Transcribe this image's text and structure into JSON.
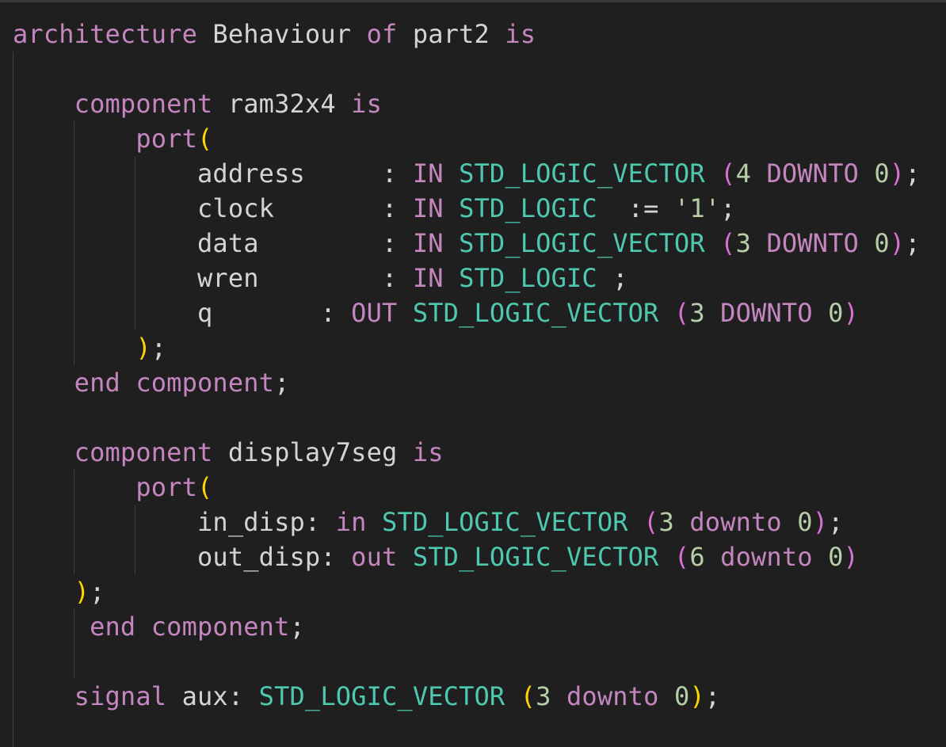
{
  "theme": {
    "background": "#1f1f1f",
    "keyword": "#c586c0",
    "identifier": "#d4d4d4",
    "type": "#4ec9b0",
    "number": "#b5cea8",
    "bracket_level1": "#ffd700",
    "bracket_level2": "#da70d6",
    "string": "#ce9178"
  },
  "lines": [
    {
      "tokens": [
        {
          "text": "architecture",
          "kind": "kw"
        },
        {
          "text": " Behaviour ",
          "kind": "id"
        },
        {
          "text": "of",
          "kind": "kw"
        },
        {
          "text": " part2 ",
          "kind": "id"
        },
        {
          "text": "is",
          "kind": "kw"
        }
      ]
    },
    {
      "tokens": []
    },
    {
      "tokens": [
        {
          "text": "    "
        },
        {
          "text": "component",
          "kind": "kw"
        },
        {
          "text": " ram32x4 ",
          "kind": "id"
        },
        {
          "text": "is",
          "kind": "kw"
        }
      ]
    },
    {
      "tokens": [
        {
          "text": "        "
        },
        {
          "text": "port",
          "kind": "kw"
        },
        {
          "text": "(",
          "kind": "paren1"
        }
      ]
    },
    {
      "tokens": [
        {
          "text": "            "
        },
        {
          "text": "address     : ",
          "kind": "id"
        },
        {
          "text": "IN",
          "kind": "kw"
        },
        {
          "text": " "
        },
        {
          "text": "STD_LOGIC_VECTOR",
          "kind": "type"
        },
        {
          "text": " "
        },
        {
          "text": "(",
          "kind": "paren2"
        },
        {
          "text": "4",
          "kind": "num"
        },
        {
          "text": " "
        },
        {
          "text": "DOWNTO",
          "kind": "kw"
        },
        {
          "text": " "
        },
        {
          "text": "0",
          "kind": "num"
        },
        {
          "text": ")",
          "kind": "paren2"
        },
        {
          "text": ";",
          "kind": "punc"
        }
      ]
    },
    {
      "tokens": [
        {
          "text": "            "
        },
        {
          "text": "clock       : ",
          "kind": "id"
        },
        {
          "text": "IN",
          "kind": "kw"
        },
        {
          "text": " "
        },
        {
          "text": "STD_LOGIC",
          "kind": "type"
        },
        {
          "text": "  := ",
          "kind": "punc"
        },
        {
          "text": "'1'",
          "kind": "num"
        },
        {
          "text": ";",
          "kind": "punc"
        }
      ]
    },
    {
      "tokens": [
        {
          "text": "            "
        },
        {
          "text": "data        : ",
          "kind": "id"
        },
        {
          "text": "IN",
          "kind": "kw"
        },
        {
          "text": " "
        },
        {
          "text": "STD_LOGIC_VECTOR",
          "kind": "type"
        },
        {
          "text": " "
        },
        {
          "text": "(",
          "kind": "paren2"
        },
        {
          "text": "3",
          "kind": "num"
        },
        {
          "text": " "
        },
        {
          "text": "DOWNTO",
          "kind": "kw"
        },
        {
          "text": " "
        },
        {
          "text": "0",
          "kind": "num"
        },
        {
          "text": ")",
          "kind": "paren2"
        },
        {
          "text": ";",
          "kind": "punc"
        }
      ]
    },
    {
      "tokens": [
        {
          "text": "            "
        },
        {
          "text": "wren        : ",
          "kind": "id"
        },
        {
          "text": "IN",
          "kind": "kw"
        },
        {
          "text": " "
        },
        {
          "text": "STD_LOGIC",
          "kind": "type"
        },
        {
          "text": " ;",
          "kind": "punc"
        }
      ]
    },
    {
      "tokens": [
        {
          "text": "            "
        },
        {
          "text": "q       : ",
          "kind": "id"
        },
        {
          "text": "OUT",
          "kind": "kw"
        },
        {
          "text": " "
        },
        {
          "text": "STD_LOGIC_VECTOR",
          "kind": "type"
        },
        {
          "text": " "
        },
        {
          "text": "(",
          "kind": "paren2"
        },
        {
          "text": "3",
          "kind": "num"
        },
        {
          "text": " "
        },
        {
          "text": "DOWNTO",
          "kind": "kw"
        },
        {
          "text": " "
        },
        {
          "text": "0",
          "kind": "num"
        },
        {
          "text": ")",
          "kind": "paren2"
        }
      ]
    },
    {
      "tokens": [
        {
          "text": "        "
        },
        {
          "text": ")",
          "kind": "paren1"
        },
        {
          "text": ";",
          "kind": "punc"
        }
      ]
    },
    {
      "tokens": [
        {
          "text": "    "
        },
        {
          "text": "end",
          "kind": "kw"
        },
        {
          "text": " "
        },
        {
          "text": "component",
          "kind": "kw"
        },
        {
          "text": ";",
          "kind": "punc"
        }
      ]
    },
    {
      "tokens": []
    },
    {
      "tokens": [
        {
          "text": "    "
        },
        {
          "text": "component",
          "kind": "kw"
        },
        {
          "text": " display7seg ",
          "kind": "id"
        },
        {
          "text": "is",
          "kind": "kw"
        }
      ]
    },
    {
      "tokens": [
        {
          "text": "        "
        },
        {
          "text": "port",
          "kind": "kw"
        },
        {
          "text": "(",
          "kind": "paren1"
        }
      ]
    },
    {
      "tokens": [
        {
          "text": "            "
        },
        {
          "text": "in_disp: ",
          "kind": "id"
        },
        {
          "text": "in",
          "kind": "kw"
        },
        {
          "text": " "
        },
        {
          "text": "STD_LOGIC_VECTOR",
          "kind": "type"
        },
        {
          "text": " "
        },
        {
          "text": "(",
          "kind": "paren2"
        },
        {
          "text": "3",
          "kind": "num"
        },
        {
          "text": " "
        },
        {
          "text": "downto",
          "kind": "kw"
        },
        {
          "text": " "
        },
        {
          "text": "0",
          "kind": "num"
        },
        {
          "text": ")",
          "kind": "paren2"
        },
        {
          "text": ";",
          "kind": "punc"
        }
      ]
    },
    {
      "tokens": [
        {
          "text": "            "
        },
        {
          "text": "out_disp: ",
          "kind": "id"
        },
        {
          "text": "out",
          "kind": "kw"
        },
        {
          "text": " "
        },
        {
          "text": "STD_LOGIC_VECTOR",
          "kind": "type"
        },
        {
          "text": " "
        },
        {
          "text": "(",
          "kind": "paren2"
        },
        {
          "text": "6",
          "kind": "num"
        },
        {
          "text": " "
        },
        {
          "text": "downto",
          "kind": "kw"
        },
        {
          "text": " "
        },
        {
          "text": "0",
          "kind": "num"
        },
        {
          "text": ")",
          "kind": "paren2"
        }
      ]
    },
    {
      "tokens": [
        {
          "text": "    "
        },
        {
          "text": ")",
          "kind": "paren1"
        },
        {
          "text": ";",
          "kind": "punc"
        }
      ]
    },
    {
      "tokens": [
        {
          "text": "     "
        },
        {
          "text": "end",
          "kind": "kw"
        },
        {
          "text": " "
        },
        {
          "text": "component",
          "kind": "kw"
        },
        {
          "text": ";",
          "kind": "punc"
        }
      ]
    },
    {
      "tokens": []
    },
    {
      "tokens": [
        {
          "text": "    "
        },
        {
          "text": "signal",
          "kind": "kw"
        },
        {
          "text": " aux: ",
          "kind": "id"
        },
        {
          "text": "STD_LOGIC_VECTOR",
          "kind": "type"
        },
        {
          "text": " "
        },
        {
          "text": "(",
          "kind": "paren1"
        },
        {
          "text": "3",
          "kind": "num"
        },
        {
          "text": " "
        },
        {
          "text": "downto",
          "kind": "kw"
        },
        {
          "text": " "
        },
        {
          "text": "0",
          "kind": "num"
        },
        {
          "text": ")",
          "kind": "paren1"
        },
        {
          "text": ";",
          "kind": "punc"
        }
      ]
    }
  ]
}
